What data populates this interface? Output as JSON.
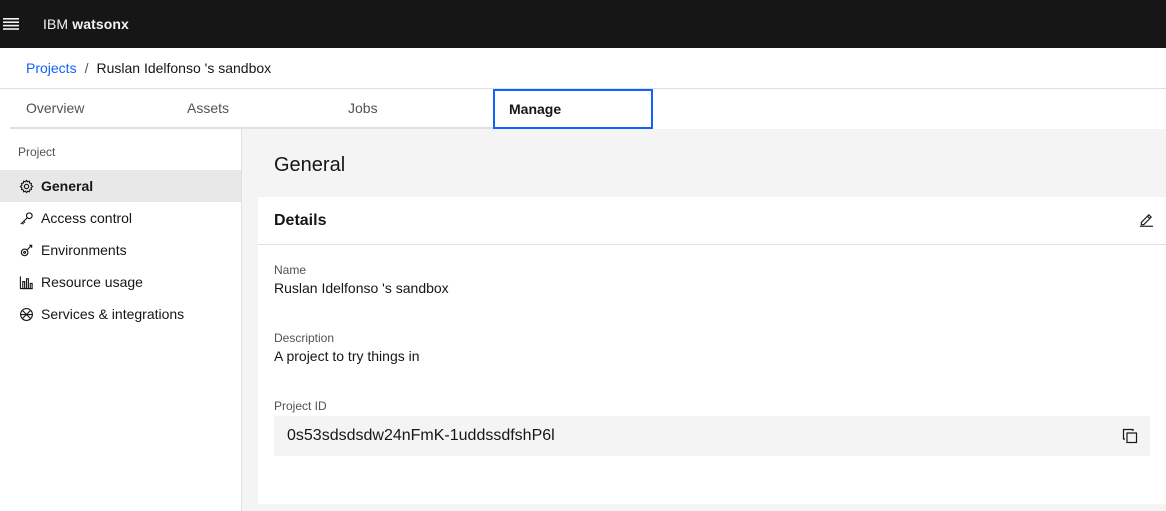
{
  "header": {
    "brand_prefix": "IBM",
    "brand_product": "watsonx",
    "menu_icon": "hamburger-menu-icon"
  },
  "breadcrumb": {
    "parent": "Projects",
    "separator": "/",
    "current": "Ruslan Idelfonso 's sandbox"
  },
  "tabs": [
    {
      "label": "Overview",
      "active": false
    },
    {
      "label": "Assets",
      "active": false
    },
    {
      "label": "Jobs",
      "active": false
    },
    {
      "label": "Manage",
      "active": true
    }
  ],
  "sidebar": {
    "section_label": "Project",
    "items": [
      {
        "label": "General",
        "icon": "gear-icon",
        "active": true
      },
      {
        "label": "Access control",
        "icon": "key-icon",
        "active": false
      },
      {
        "label": "Environments",
        "icon": "environment-icon",
        "active": false
      },
      {
        "label": "Resource usage",
        "icon": "bar-chart-icon",
        "active": false
      },
      {
        "label": "Services & integrations",
        "icon": "integrations-icon",
        "active": false
      }
    ]
  },
  "main": {
    "title": "General",
    "details": {
      "heading": "Details",
      "edit_icon": "edit-pencil-icon",
      "name_label": "Name",
      "name_value": "Ruslan Idelfonso 's sandbox",
      "description_label": "Description",
      "description_value": "A project to try things in",
      "project_id_label": "Project ID",
      "project_id_value": "0s53sdsdsdw24nFmK-1uddssdfshP6l",
      "copy_icon": "copy-icon"
    }
  },
  "colors": {
    "header_bg": "#161616",
    "link": "#0f62fe",
    "active_tab_border": "#0f62fe",
    "main_bg": "#f4f4f4",
    "sidebar_active_bg": "#e8e8e8"
  }
}
